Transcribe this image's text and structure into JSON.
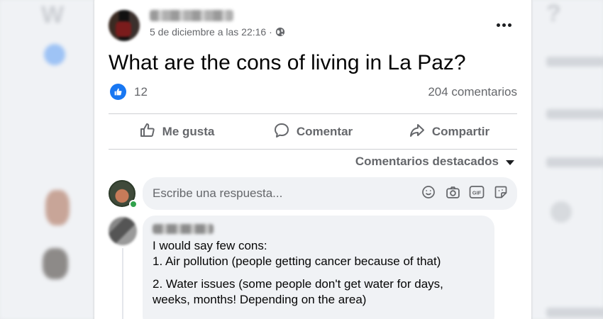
{
  "post": {
    "timestamp": "5 de diciembre a las 22:16 ·",
    "text": "What are the cons of living in La Paz?",
    "like_count": "12",
    "comment_count": "204 comentarios"
  },
  "actions": {
    "like_label": "Me gusta",
    "comment_label": "Comentar",
    "share_label": "Compartir"
  },
  "comments_sort": {
    "label": "Comentarios destacados"
  },
  "reply": {
    "placeholder": "Escribe una respuesta..."
  },
  "comment": {
    "lines": [
      "I would say few cons:",
      "1. Air pollution (people getting cancer because of that)",
      "2. Water issues (some people don't get water for days,",
      "weeks, months! Depending on the area)"
    ]
  },
  "colors": {
    "brand_blue": "#1877f2",
    "secondary_text": "#65676b",
    "online_green": "#31a24c"
  },
  "icons": [
    "globe-icon",
    "more-icon",
    "like-icon",
    "comment-icon",
    "share-icon",
    "caret-down-icon",
    "emoji-icon",
    "camera-icon",
    "gif-icon",
    "sticker-icon"
  ]
}
